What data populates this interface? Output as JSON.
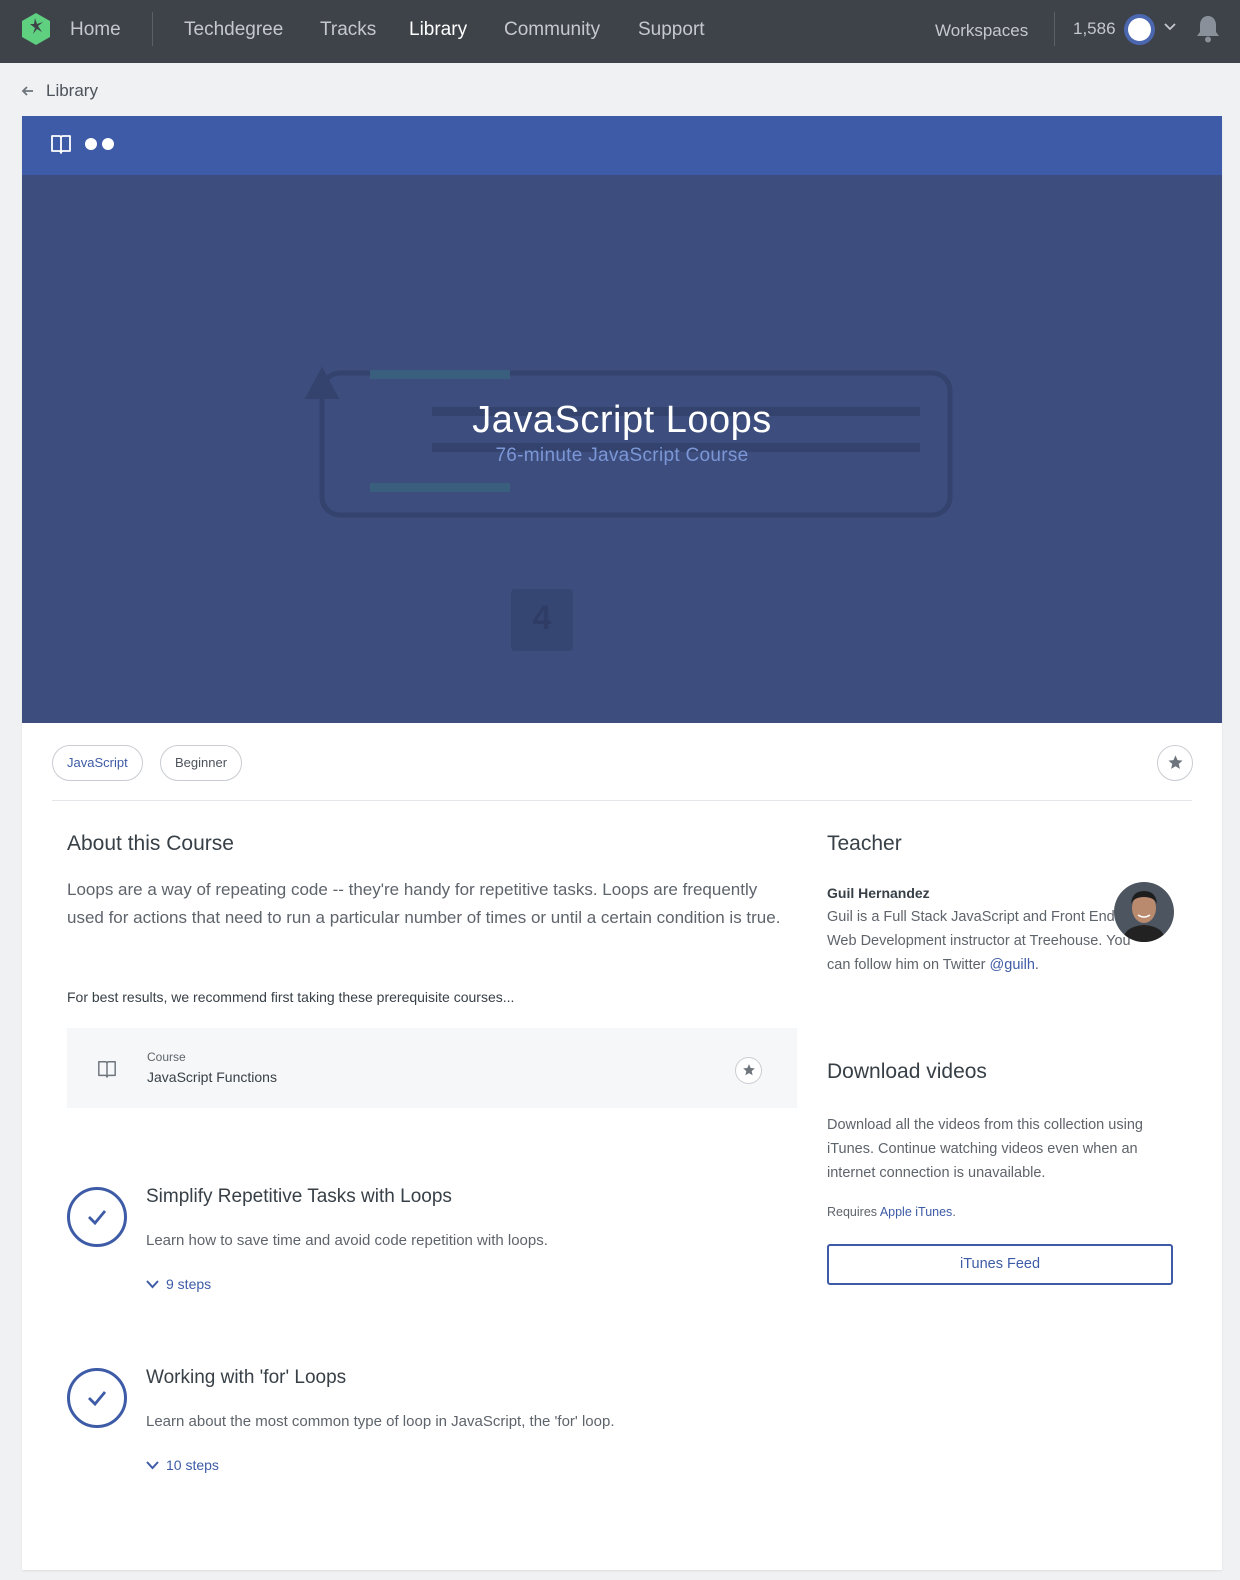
{
  "nav": {
    "links": [
      "Home",
      "Techdegree",
      "Tracks",
      "Library",
      "Community",
      "Support"
    ],
    "active": "Library",
    "workspaces": "Workspaces",
    "points": "1,586"
  },
  "breadcrumb": {
    "label": "Library"
  },
  "hero": {
    "title": "JavaScript Loops",
    "subtitle": "76-minute JavaScript Course",
    "badge_number": "4"
  },
  "tags": [
    "JavaScript",
    "Beginner"
  ],
  "about": {
    "heading": "About this Course",
    "text": "Loops are a way of repeating code -- they're handy for repetitive tasks. Loops are frequently used for actions that need to run a particular number of times or until a certain condition is true.",
    "prereq_note": "For best results, we recommend first taking these prerequisite courses..."
  },
  "prerequisite": {
    "kind": "Course",
    "name": "JavaScript Functions"
  },
  "stages": [
    {
      "title": "Simplify Repetitive Tasks with Loops",
      "description": "Learn how to save time and avoid code repetition with loops.",
      "steps": "9 steps"
    },
    {
      "title": "Working with 'for' Loops",
      "description": "Learn about the most common type of loop in JavaScript, the 'for' loop.",
      "steps": "10 steps"
    }
  ],
  "teacher": {
    "heading": "Teacher",
    "name": "Guil Hernandez",
    "bio_before": "Guil is a Full Stack JavaScript and Front End Web Development instructor at Treehouse. You can follow him on Twitter ",
    "twitter": "@guilh",
    "bio_after": "."
  },
  "download": {
    "heading": "Download videos",
    "text": "Download all the videos from this collection using iTunes. Continue watching videos even when an internet connection is unavailable.",
    "requires_prefix": "Requires ",
    "requires_link": "Apple iTunes",
    "requires_suffix": ".",
    "button": "iTunes Feed"
  },
  "colors": {
    "nav_bg": "#3e4249",
    "brand_blue": "#3d5ba6",
    "hero_bg": "#3c4d7e",
    "treehouse_green": "#5fcf80"
  }
}
